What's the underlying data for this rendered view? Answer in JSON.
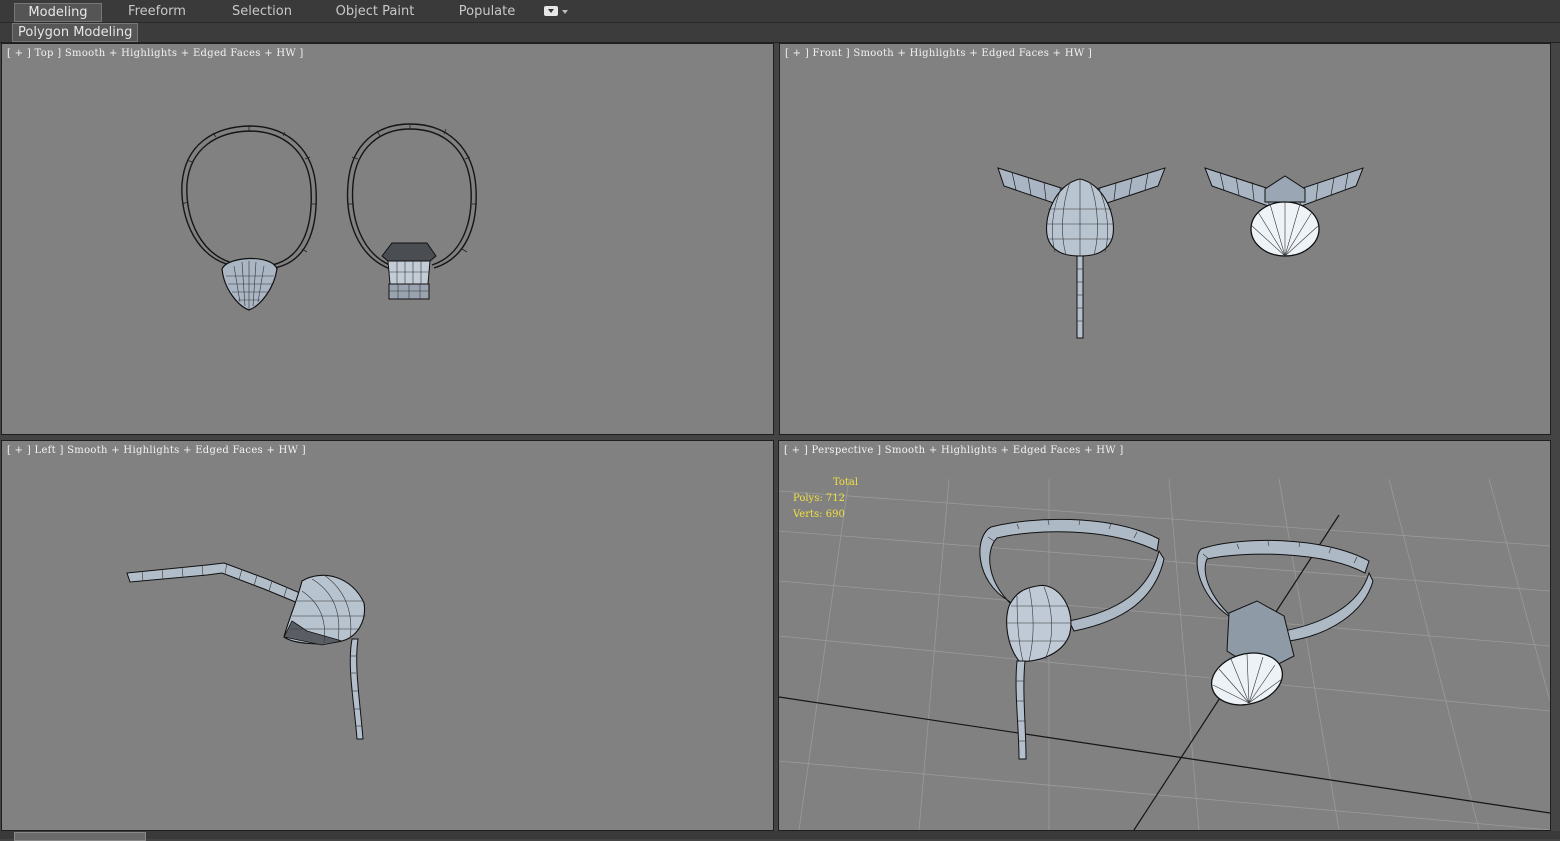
{
  "ribbon": {
    "tabs": [
      "Modeling",
      "Freeform",
      "Selection",
      "Object Paint",
      "Populate"
    ],
    "active_tab": "Modeling",
    "panel_tab": "Polygon Modeling"
  },
  "viewports": {
    "top": {
      "label": "[ + ] Top ] Smooth + Highlights + Edged Faces + HW ]"
    },
    "front": {
      "label": "[ + ] Front ] Smooth + Highlights + Edged Faces + HW ]"
    },
    "left": {
      "label": "[ + ] Left ] Smooth + Highlights + Edged Faces + HW ]"
    },
    "perspective": {
      "label": "[ + ] Perspective ] Smooth + Highlights + Edged Faces + HW ]"
    }
  },
  "stats": {
    "total_label": "Total",
    "polys_label": "Polys:",
    "polys_value": "712",
    "verts_label": "Verts:",
    "verts_value": "690"
  },
  "colors": {
    "viewport_bg": "#818181",
    "stats_text": "#f0e040",
    "mesh_fill": "#b8c4d2",
    "mesh_edge": "#1a1a1a"
  },
  "icons": [
    "dropdown-icon"
  ]
}
